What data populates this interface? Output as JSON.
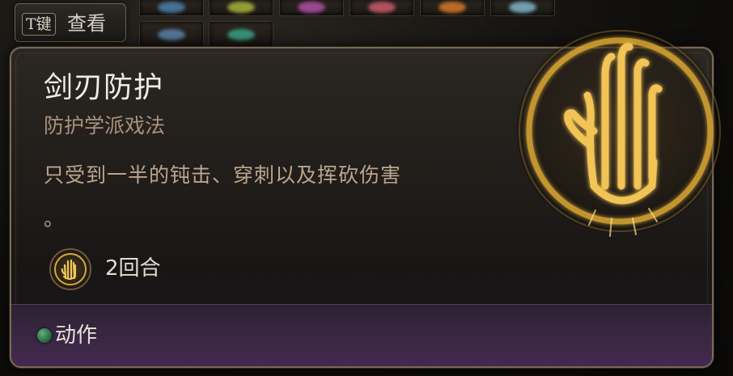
{
  "hotbar": {
    "slots_row1": [
      "#4a7fa8",
      "#a7b63a",
      "#b04fa8",
      "#c85a6a",
      "#d9782a",
      "#7fb4c8"
    ],
    "slots_row2": [
      "#5d86b0",
      "#3aa88a"
    ]
  },
  "key_hint": {
    "key": "T键",
    "label": "查看"
  },
  "tooltip": {
    "title": "剑刃防护",
    "subtitle": "防护学派戏法",
    "description": "只受到一半的钝击、穿刺以及挥砍伤害",
    "description_tail": "。",
    "duration": "2回合",
    "action_type": "动作",
    "icon": "blade-ward-hand-icon",
    "accent_color": "#e8b840",
    "action_dot_color": "#3c8a55"
  }
}
